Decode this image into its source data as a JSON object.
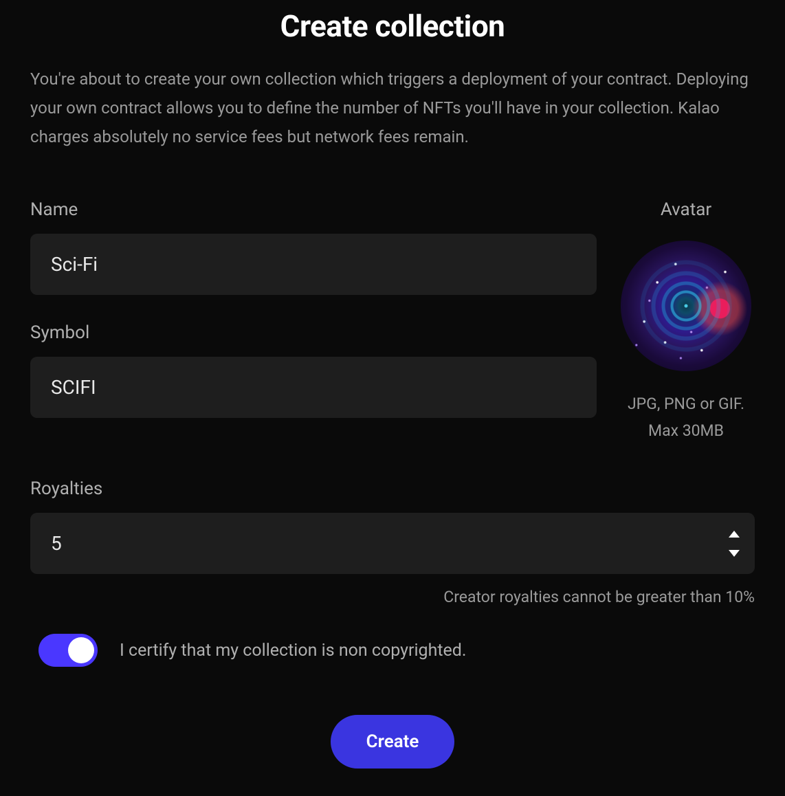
{
  "title": "Create collection",
  "intro": "You're about to create your own collection which triggers a deployment of your contract. Deploying your own contract allows you to define the number of NFTs you'll have in your collection. Kalao charges absolutely no service fees but network fees remain.",
  "fields": {
    "name": {
      "label": "Name",
      "value": "Sci-Fi"
    },
    "symbol": {
      "label": "Symbol",
      "value": "SCIFI"
    },
    "royalties": {
      "label": "Royalties",
      "value": "5",
      "hint": "Creator royalties cannot be greater than 10%"
    }
  },
  "avatar": {
    "label": "Avatar",
    "hint_line1": "JPG, PNG or GIF.",
    "hint_line2": "Max 30MB"
  },
  "certify": {
    "label": "I certify that my collection is non copyrighted.",
    "checked": true
  },
  "actions": {
    "create_label": "Create"
  },
  "colors": {
    "accent": "#3a35e0",
    "toggle": "#4a37ff"
  }
}
